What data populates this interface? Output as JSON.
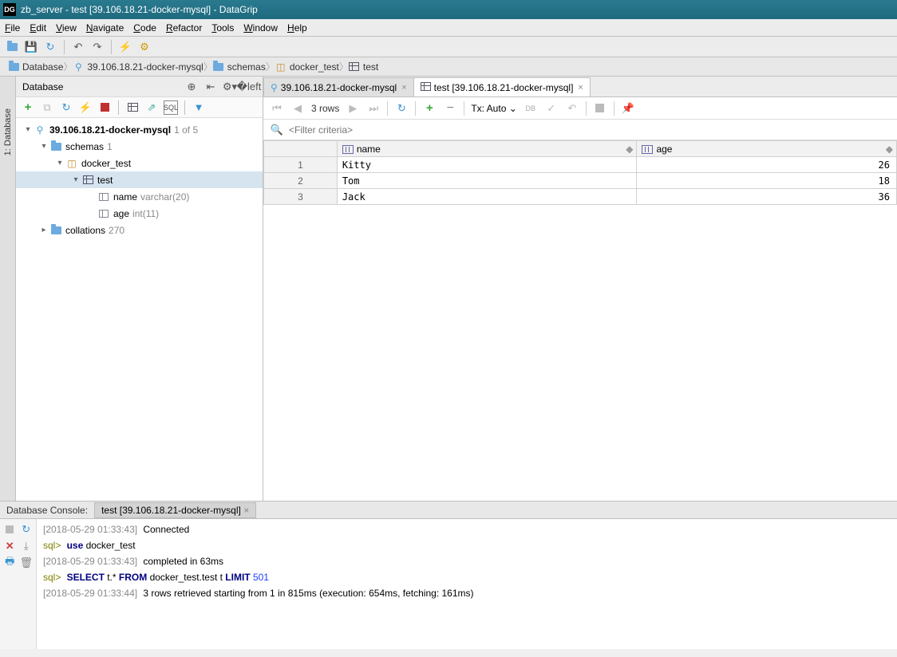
{
  "window": {
    "title": "zb_server - test [39.106.18.21-docker-mysql] - DataGrip"
  },
  "menu": {
    "file": "File",
    "edit": "Edit",
    "view": "View",
    "navigate": "Navigate",
    "code": "Code",
    "refactor": "Refactor",
    "tools": "Tools",
    "window": "Window",
    "help": "Help"
  },
  "breadcrumb": {
    "root": "Database",
    "b1": "39.106.18.21-docker-mysql",
    "b2": "schemas",
    "b3": "docker_test",
    "b4": "test"
  },
  "sidebar": {
    "tab": "1: Database",
    "title": "Database"
  },
  "tree": {
    "ds": "39.106.18.21-docker-mysql",
    "ds_meta": "1 of 5",
    "schemas": "schemas",
    "schemas_meta": "1",
    "db": "docker_test",
    "table": "test",
    "col1": "name",
    "col1_type": "varchar(20)",
    "col2": "age",
    "col2_type": "int(11)",
    "collations": "collations",
    "collations_meta": "270"
  },
  "tabs": {
    "t1": "39.106.18.21-docker-mysql",
    "t2": "test [39.106.18.21-docker-mysql]"
  },
  "etoolbar": {
    "rows": "3 rows",
    "tx": "Tx: Auto",
    "db": "DB"
  },
  "filter": {
    "placeholder": "<Filter criteria>"
  },
  "grid": {
    "h1": "name",
    "h2": "age",
    "rows": [
      {
        "n": "1",
        "name": "Kitty",
        "age": "26"
      },
      {
        "n": "2",
        "name": "Tom",
        "age": "18"
      },
      {
        "n": "3",
        "name": "Jack",
        "age": "36"
      }
    ]
  },
  "console": {
    "label": "Database Console:",
    "tab": "test [39.106.18.21-docker-mysql]",
    "l1_ts": "[2018-05-29 01:33:43]",
    "l1_txt": "Connected",
    "l2_p": "sql>",
    "l2_kw": "use",
    "l2_txt": " docker_test",
    "l3_ts": "[2018-05-29 01:33:43]",
    "l3_txt": "completed in 63ms",
    "l4_p": "sql>",
    "l4_kw1": "SELECT",
    "l4_t1": " t.* ",
    "l4_kw2": "FROM",
    "l4_t2": " docker_test.test t ",
    "l4_kw3": "LIMIT",
    "l4_num": " 501",
    "l5_ts": "[2018-05-29 01:33:44]",
    "l5_txt": "3 rows retrieved starting from 1 in 815ms (execution: 654ms, fetching: 161ms)"
  }
}
